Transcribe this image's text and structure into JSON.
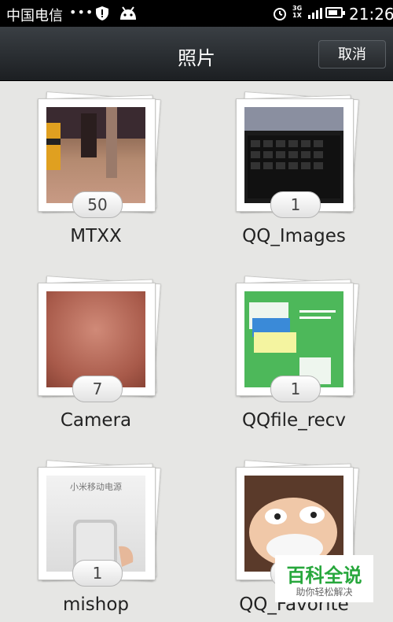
{
  "status_bar": {
    "carrier": "中国电信",
    "dots": "•••",
    "network": "3G 1X",
    "time": "21:26",
    "battery_level": 0.8
  },
  "header": {
    "title": "照片",
    "cancel_label": "取消"
  },
  "albums": [
    {
      "name": "MTXX",
      "count": "50"
    },
    {
      "name": "QQ_Images",
      "count": "1"
    },
    {
      "name": "Camera",
      "count": "7"
    },
    {
      "name": "QQfile_recv",
      "count": "1"
    },
    {
      "name": "mishop",
      "count": "1",
      "thumb_text": "小米移动电源"
    },
    {
      "name": "QQ_Favorite",
      "count": "1"
    }
  ],
  "watermark": {
    "line1": "百科全说",
    "line2": "助你轻松解决"
  }
}
